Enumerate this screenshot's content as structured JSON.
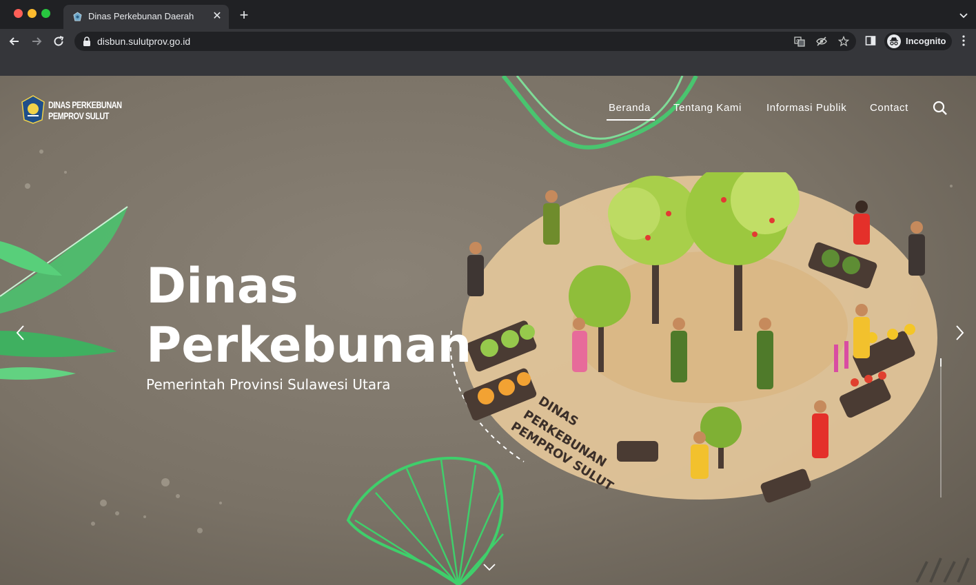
{
  "browser": {
    "tab_title": "Dinas Perkebunan Daerah",
    "url": "disbun.sulutprov.go.id",
    "incognito_label": "Incognito"
  },
  "site": {
    "logo": {
      "line1": "DINAS PERKEBUNAN",
      "line2": "PEMPROV SULUT"
    },
    "nav": [
      {
        "label": "Beranda",
        "active": true
      },
      {
        "label": "Tentang Kami"
      },
      {
        "label": "Informasi Publik"
      },
      {
        "label": "Contact"
      }
    ],
    "hero": {
      "title_line1": "Dinas",
      "title_line2": "Perkebunan",
      "subtitle": "Pemerintah Provinsi Sulawesi Utara",
      "illustration_text": [
        "DINAS",
        "PERKEBUNAN",
        "PEMPROV SULUT"
      ]
    },
    "slider_progress": 0.06
  },
  "colors": {
    "background": "#7a7266",
    "accent_green": "#3fc46a",
    "nav_text": "#ffffff"
  },
  "icons": [
    "search-icon",
    "chevron-left-icon",
    "chevron-right-icon",
    "chevron-down-icon",
    "lock-icon",
    "incognito-icon"
  ]
}
